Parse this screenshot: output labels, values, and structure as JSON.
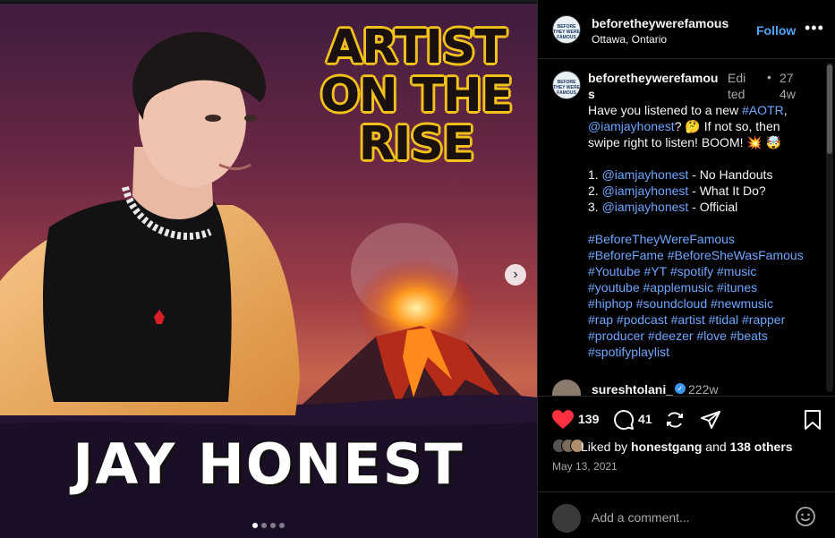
{
  "post": {
    "title_lines": [
      "ARTIST",
      "ON THE",
      "RISE"
    ],
    "artist_name": "JAY HONEST",
    "carousel_dots": 4,
    "carousel_active": 0
  },
  "header": {
    "username": "beforetheywerefamous",
    "location": "Ottawa, Ontario",
    "follow_label": "Follow",
    "more_label": "•••",
    "avatar_text": "BEFORE THEY WERE FAMOUS"
  },
  "caption": {
    "username": "beforetheywerefamou s",
    "edited": "Edited",
    "bullet": "•",
    "age": "274w",
    "line1_pre": "Have you listened to a new ",
    "line1_tag": "#AOTR",
    "line1_post": ",",
    "line2_mention": "@iamjayhonest",
    "line2_post": "? 🤔 If not so, then",
    "line3": "swipe right to listen! BOOM! 💥 🤯",
    "tracks": [
      {
        "num": "1. ",
        "mention": "@iamjayhonest",
        "title": " - No Handouts"
      },
      {
        "num": "2. ",
        "mention": "@iamjayhonest",
        "title": " - What It Do?"
      },
      {
        "num": "3. ",
        "mention": "@iamjayhonest",
        "title": " - Official"
      }
    ],
    "hashtag_lines": [
      "#BeforeTheyWereFamous",
      "#BeforeFame #BeforeSheWasFamous",
      "#Youtube #YT #spotify #music",
      "#youtube #applemusic #itunes",
      "#hiphop #soundcloud #newmusic",
      "#rap #podcast #artist #tidal #rapper",
      "#producer #deezer #love #beats",
      "#spotifyplaylist"
    ]
  },
  "comment": {
    "username": "sureshtolani_",
    "verified": "✓",
    "age": "222w"
  },
  "actions": {
    "likes": "139",
    "comments": "41",
    "liked_by_prefix": "Liked by ",
    "liked_by_user": "honestgang",
    "liked_by_suffix": " and ",
    "liked_by_others": "138 others",
    "date": "May 13, 2021",
    "comment_placeholder": "Add a comment..."
  },
  "colors": {
    "link": "#6fa6ff",
    "follow": "#4ea3f7",
    "like": "#ff3040",
    "title_outline": "#f2c21b"
  }
}
